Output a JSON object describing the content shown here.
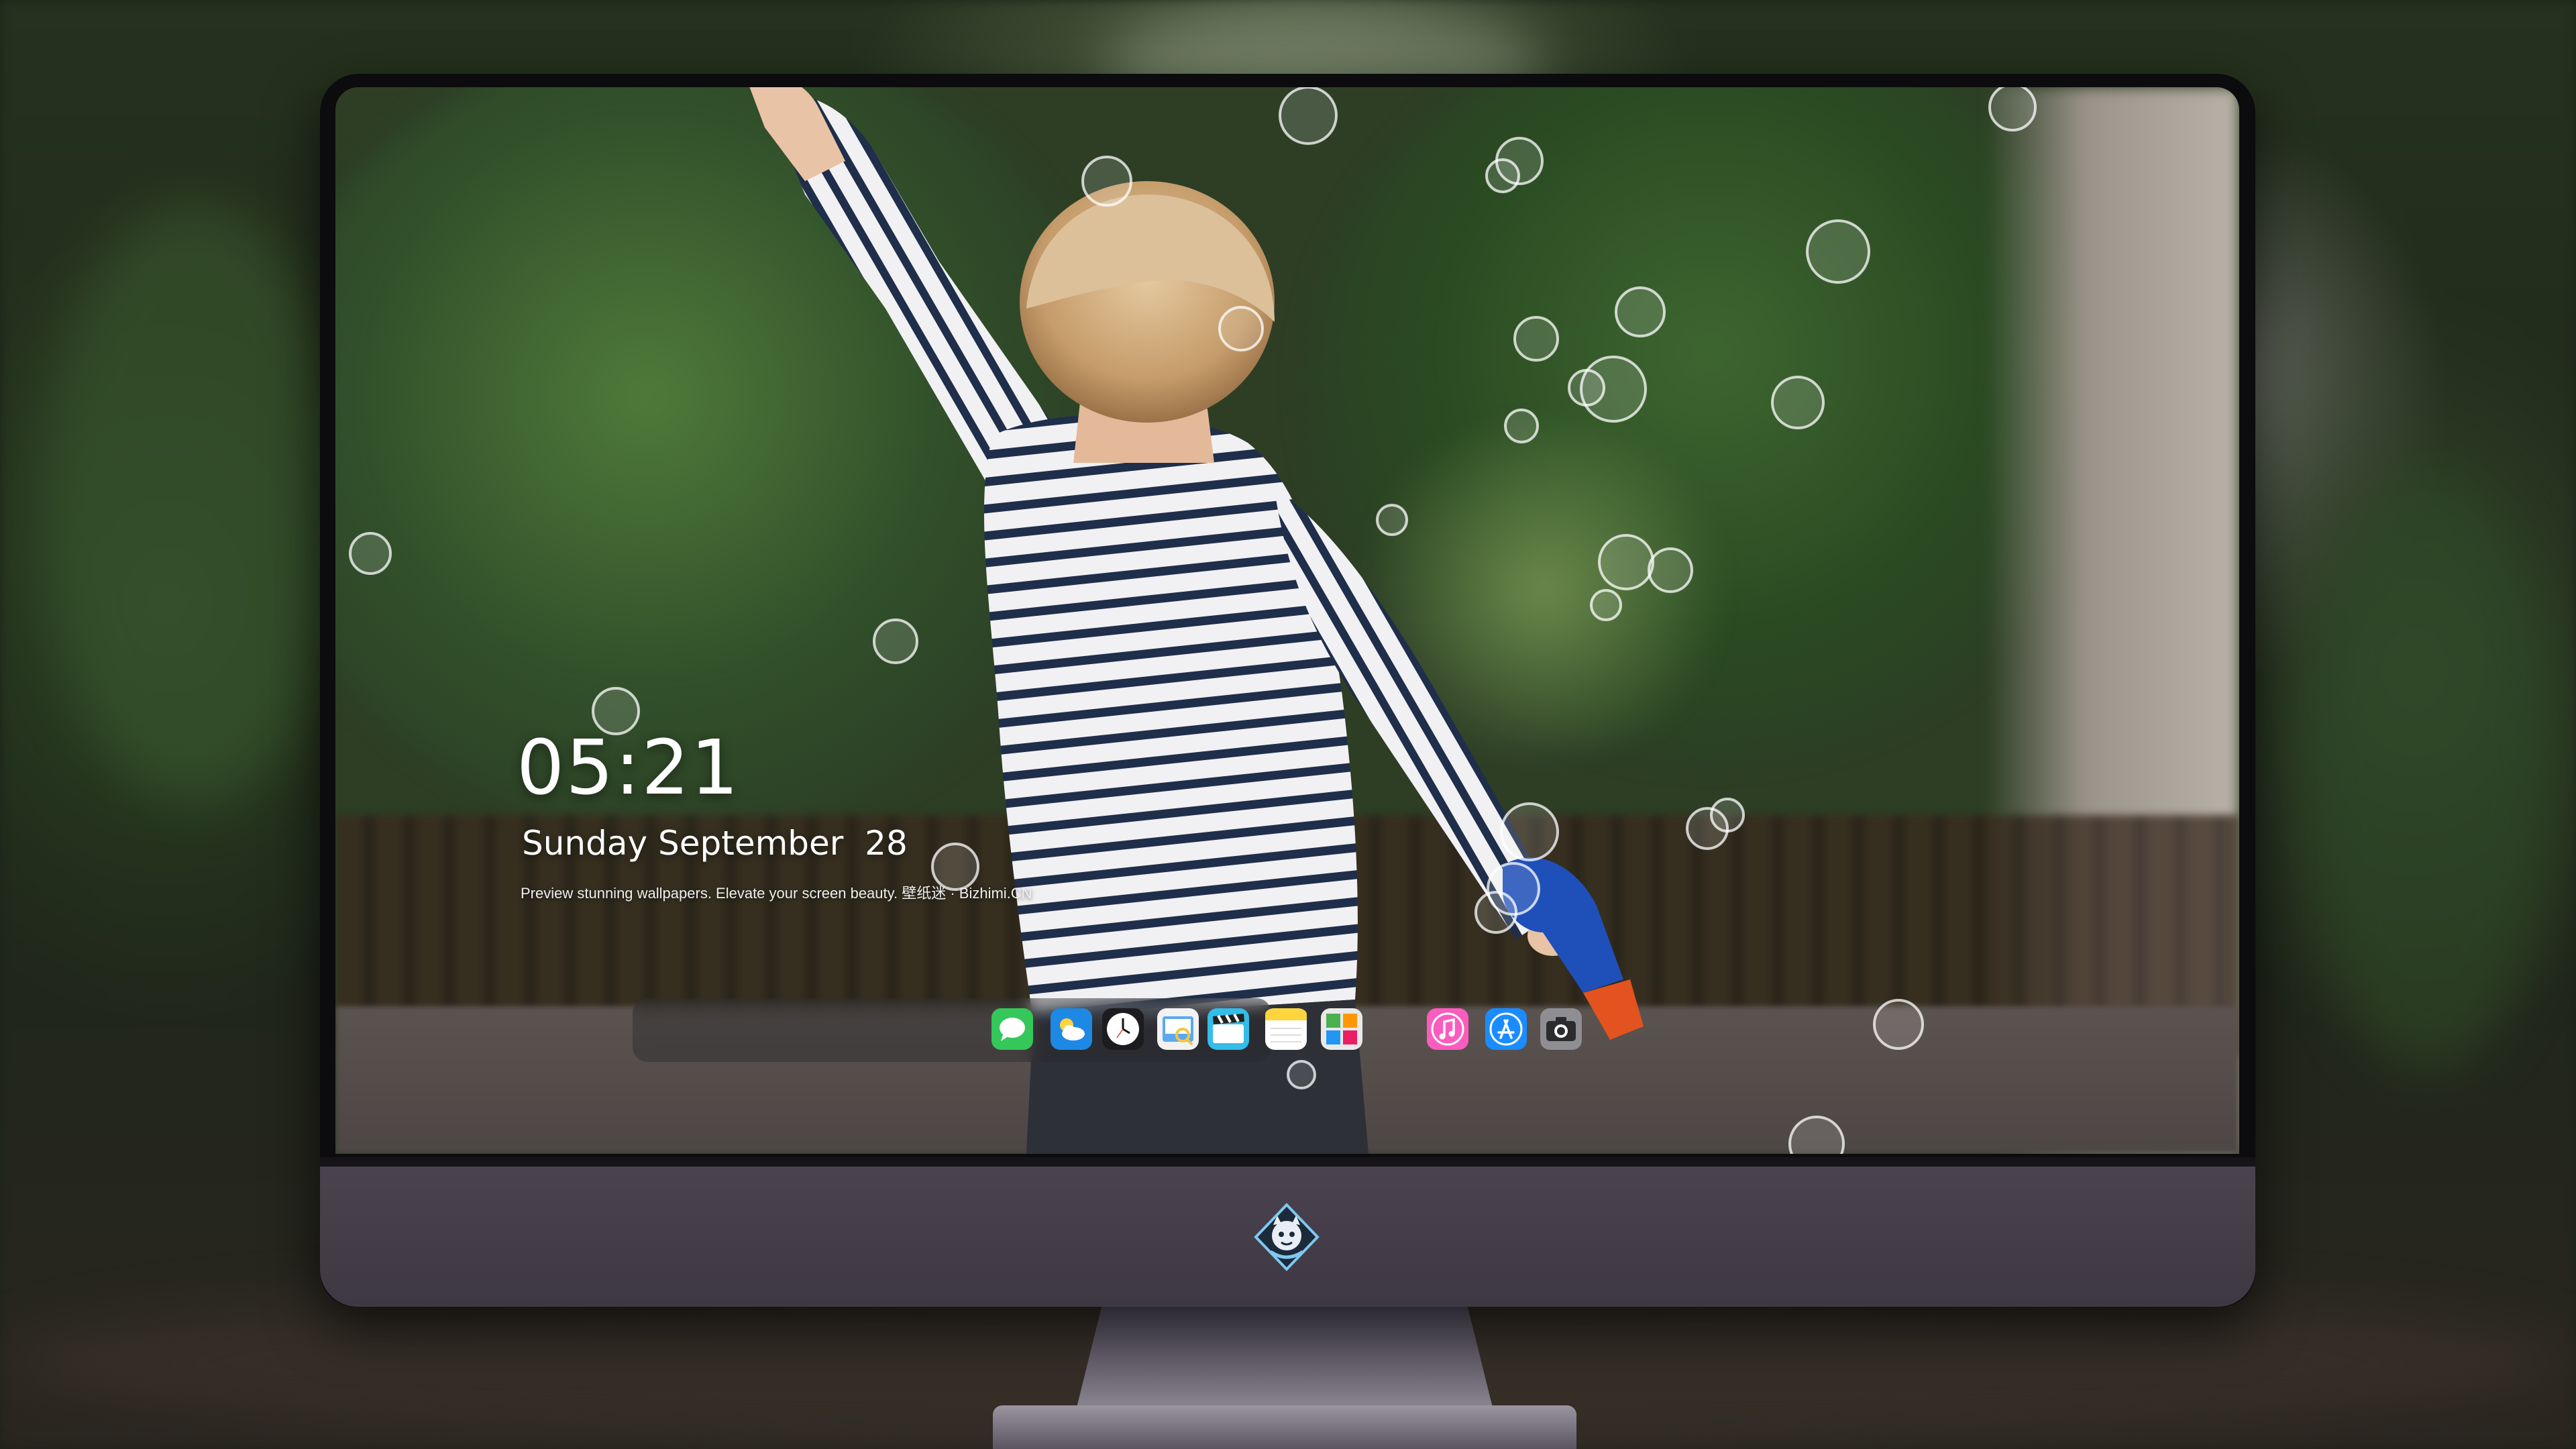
{
  "lock_screen": {
    "time": "05:21",
    "date": "Sunday September  28",
    "tagline": "Preview stunning wallpapers. Elevate your screen beauty. 壁纸迷 · Bizhimi.CN"
  },
  "dock": {
    "apps": [
      {
        "name": "Messages",
        "icon": "messages-icon",
        "color": "#34c759"
      },
      {
        "name": "Weather",
        "icon": "weather-icon",
        "color": "#1e88e5"
      },
      {
        "name": "Clock",
        "icon": "clock-icon",
        "color": "#1c1c1e"
      },
      {
        "name": "Preview",
        "icon": "preview-icon",
        "color": "#f5c542"
      },
      {
        "name": "Clips",
        "icon": "clapperboard-icon",
        "color": "#33bde8"
      },
      {
        "name": "Notes",
        "icon": "notes-icon",
        "color": "#ffd53d"
      },
      {
        "name": "Photo Booth",
        "icon": "photo-collage-icon",
        "color": "#e9e9e9"
      },
      {
        "name": "Music",
        "icon": "music-icon",
        "color": "#fb5cbf"
      },
      {
        "name": "App Store",
        "icon": "app-store-icon",
        "color": "#1a8cff"
      },
      {
        "name": "Camera",
        "icon": "camera-icon",
        "color": "#8e8e93"
      }
    ]
  },
  "colors": {
    "bezel": "#0c0b0d",
    "chin": "#463f4b",
    "dock_background": "rgba(40,40,44,0.42)"
  }
}
